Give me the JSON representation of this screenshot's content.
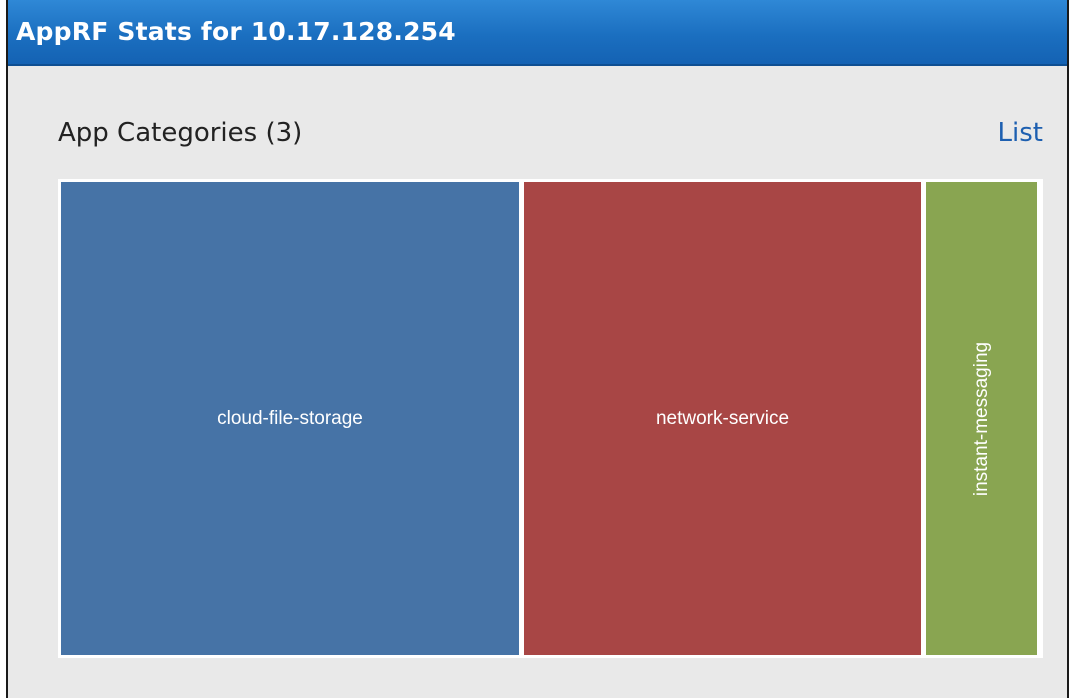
{
  "window": {
    "title": "AppRF Stats for 10.17.128.254"
  },
  "section": {
    "title": "App Categories (3)",
    "list_link": "List"
  },
  "treemap": {
    "tiles": [
      {
        "label": "cloud-file-storage",
        "color": "#4673a6",
        "orientation": "horizontal"
      },
      {
        "label": "network-service",
        "color": "#a84645",
        "orientation": "horizontal"
      },
      {
        "label": "instant-messaging",
        "color": "#89a551",
        "orientation": "vertical"
      }
    ]
  }
}
